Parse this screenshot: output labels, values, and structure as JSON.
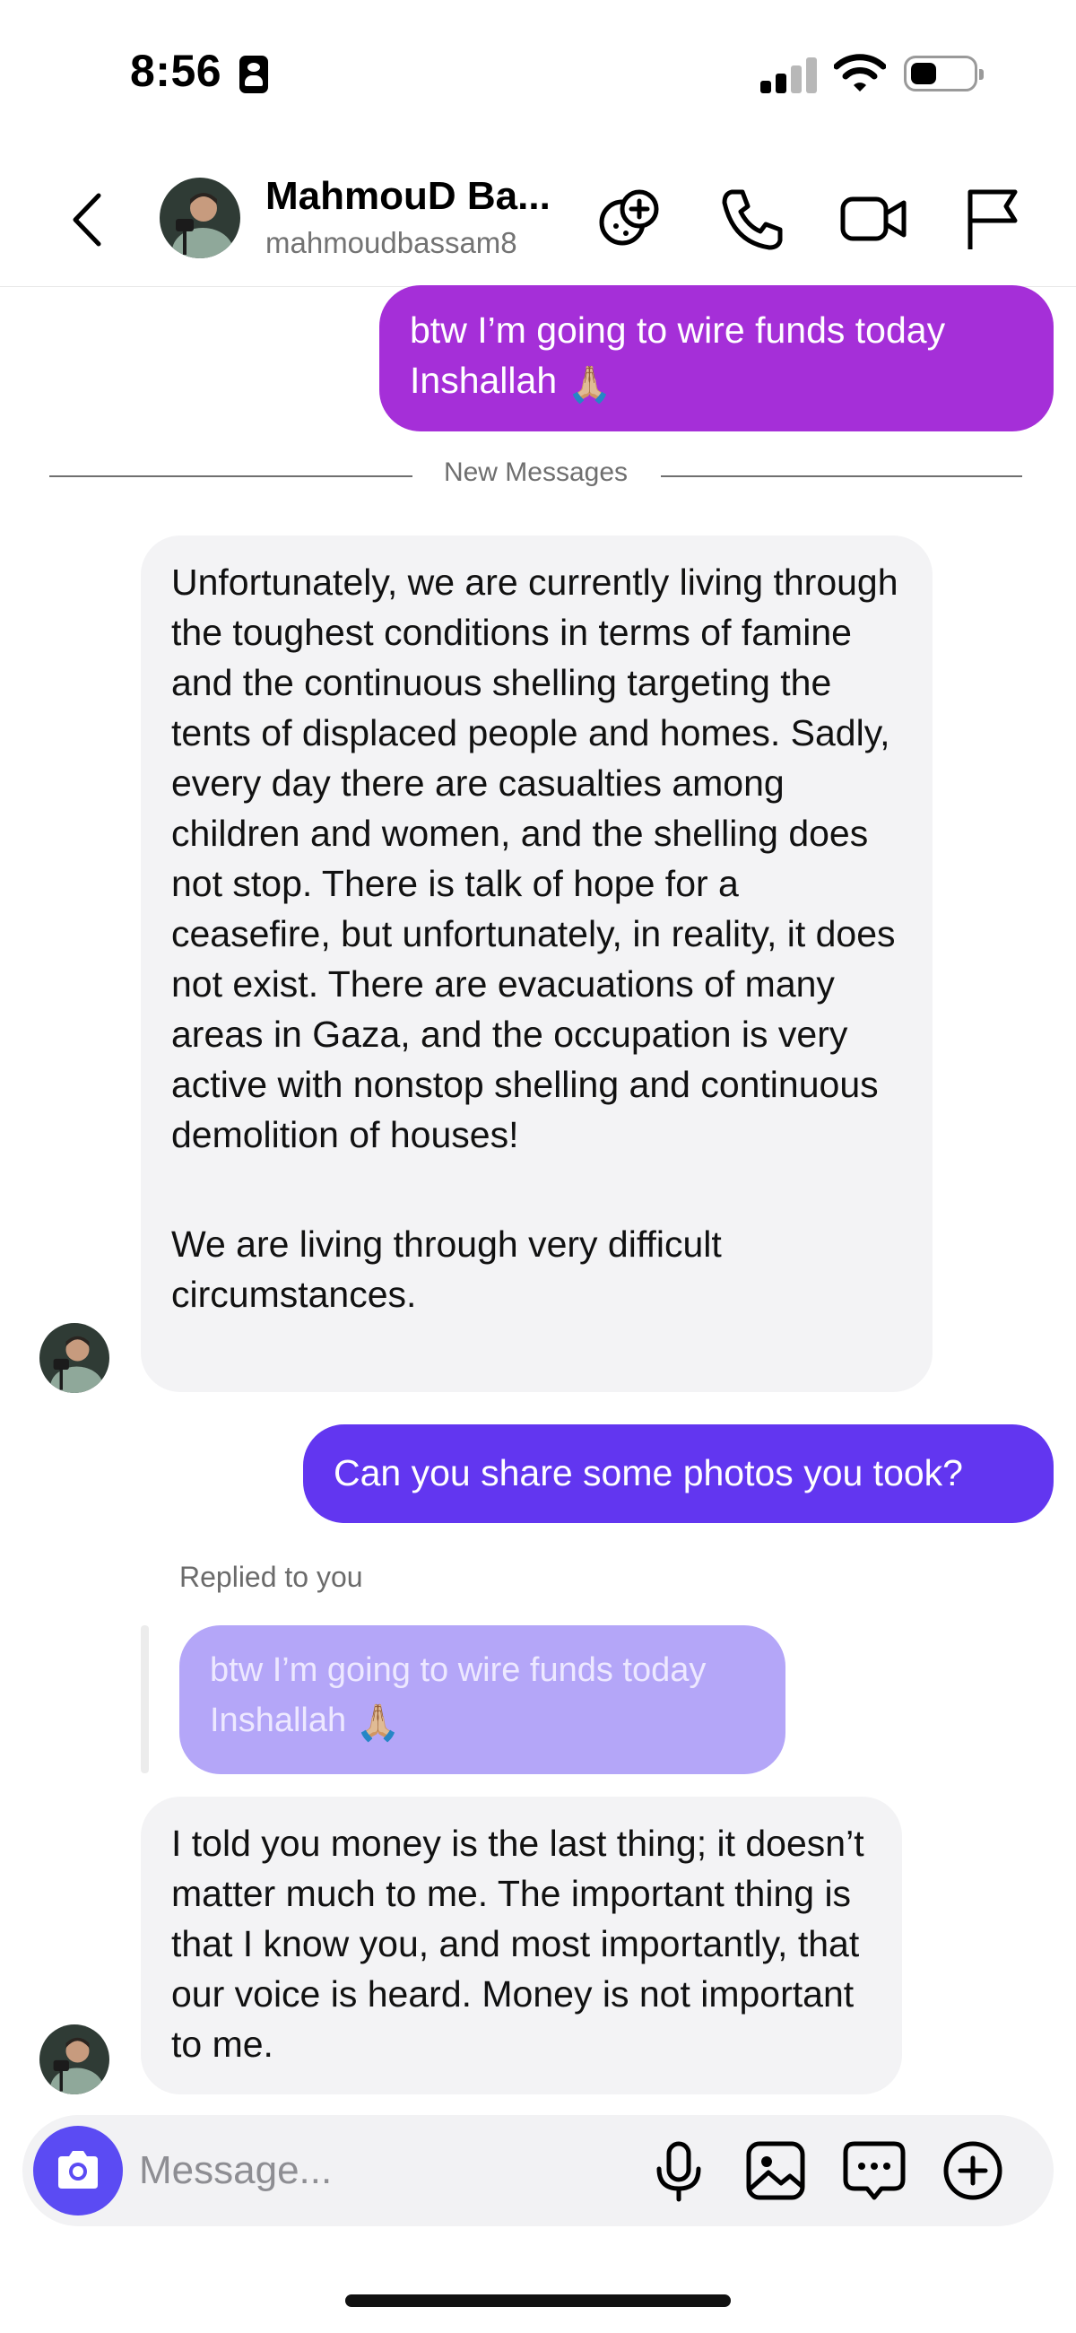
{
  "status_bar": {
    "time": "8:56"
  },
  "header": {
    "contact_name": "MahmouD Ba...",
    "contact_handle": "mahmoudbassam8"
  },
  "messages": {
    "outgoing_1": {
      "text": "btw I’m going to wire funds today Inshallah",
      "emoji": "🙏🏼"
    },
    "divider_label": "New Messages",
    "incoming_1": {
      "paragraph_1": "Unfortunately, we are currently living through the toughest conditions in terms of famine and the continuous shelling targeting the tents of displaced people and homes. Sadly, every day there are casualties among children and women, and the shelling does not stop. There is talk of hope for a ceasefire, but unfortunately, in reality, it does not exist. There are evacuations of many areas in Gaza, and the occupation is very active with nonstop shelling and continuous demolition of houses!",
      "paragraph_2": "We are living through very difficult circumstances."
    },
    "outgoing_2": {
      "text": "Can you share some photos you took?"
    },
    "reply": {
      "label": "Replied to you",
      "quoted_text": "btw I’m going to wire funds today Inshallah",
      "quoted_emoji": "🙏🏼"
    },
    "incoming_2": {
      "text": "I told you money is the last thing; it doesn’t matter much to me. The important thing is that I know you, and most importantly, that our voice is heard. Money is not important to me."
    }
  },
  "composer": {
    "placeholder": "Message..."
  },
  "icons": {
    "header": [
      "chevron-left-icon",
      "add-effect-icon",
      "phone-icon",
      "video-camera-icon",
      "flag-icon"
    ],
    "composer": [
      "camera-icon",
      "microphone-icon",
      "gallery-icon",
      "sticker-chat-icon",
      "plus-circle-icon"
    ]
  },
  "colors": {
    "outgoing_1_bubble": "#a52fd8",
    "outgoing_2_bubble": "#6236f0",
    "reply_bubble": "#b4a6f8",
    "incoming_bubble": "#f3f3f5",
    "camera_button": "#5b4bf3"
  }
}
